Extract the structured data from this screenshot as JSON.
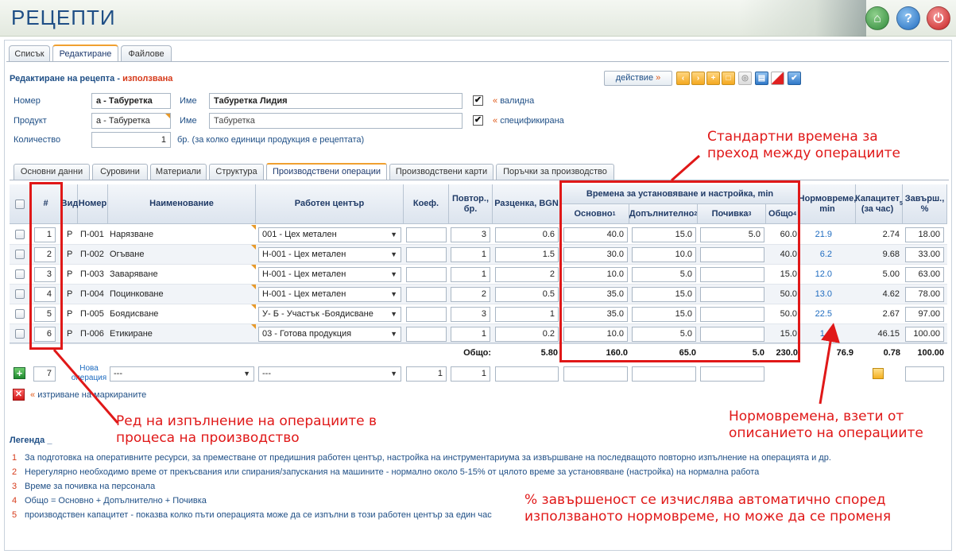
{
  "app": {
    "title": "РЕЦЕПТИ"
  },
  "header_buttons": {
    "home": "⌂",
    "help": "?",
    "power": "⏻"
  },
  "top_tabs": [
    "Списък",
    "Редактиране",
    "Файлове"
  ],
  "section": {
    "title": "Редактиране на рецепта",
    "separator": " - ",
    "status": "използвана"
  },
  "action_button": {
    "label": "действие",
    "arrow": "»"
  },
  "toolbar": [
    "‹",
    "›",
    "+",
    "□",
    "◎",
    "▤",
    "",
    "✔"
  ],
  "form": {
    "number_label": "Номер",
    "number_value": "а - Табуретка",
    "name_label": "Име",
    "name_value": "Табуретка Лидия",
    "valid_label": "валидна",
    "product_label": "Продукт",
    "product_value": "а - Табуретка",
    "name2_label": "Име",
    "name2_value": "Табуретка",
    "specified_label": "спецификирана",
    "quantity_label": "Количество",
    "quantity_value": "1",
    "quantity_hint": "бр. (за колко единици продукция е рецептата)",
    "guillemet": "«",
    "checkmark": "✔"
  },
  "sub_tabs": [
    "Основни данни",
    "Суровини",
    "Материали",
    "Структура",
    "Производствени операции",
    "Производствени карти",
    "Поръчки за производство"
  ],
  "table": {
    "headers": {
      "num": "#",
      "type": "Вид",
      "code": "Номер",
      "name": "Наименование",
      "workcenter": "Работен център",
      "coef": "Коеф.",
      "repeat": "Повтор., бр.",
      "cost": "Разценка, BGN",
      "times_group": "Времена за установяване и настройка, min",
      "basic": "Основно",
      "additional": "Допълнително",
      "rest": "Почивка",
      "total": "Общо",
      "norm": "Нормовреме, min",
      "capacity": "Капацитет (за час)",
      "completion": "Завърш., %"
    },
    "sup": {
      "basic": "1",
      "additional": "2",
      "rest": "3",
      "total": "4",
      "capacity": "5"
    },
    "rows": [
      {
        "num": "1",
        "type": "Р",
        "code": "П-001",
        "name": "Нарязване",
        "workcenter": "001 - Цех метален",
        "repeat": "3",
        "cost": "0.6",
        "basic": "40.0",
        "additional": "15.0",
        "rest": "5.0",
        "total": "60.0",
        "norm": "21.9",
        "capacity": "2.74",
        "completion": "18.00"
      },
      {
        "num": "2",
        "type": "Р",
        "code": "П-002",
        "name": "Огъване",
        "workcenter": "Н-001 - Цех метален",
        "repeat": "1",
        "cost": "1.5",
        "basic": "30.0",
        "additional": "10.0",
        "rest": "",
        "total": "40.0",
        "norm": "6.2",
        "capacity": "9.68",
        "completion": "33.00"
      },
      {
        "num": "3",
        "type": "Р",
        "code": "П-003",
        "name": "Заваряване",
        "workcenter": "Н-001 - Цех метален",
        "repeat": "1",
        "cost": "2",
        "basic": "10.0",
        "additional": "5.0",
        "rest": "",
        "total": "15.0",
        "norm": "12.0",
        "capacity": "5.00",
        "completion": "63.00"
      },
      {
        "num": "4",
        "type": "Р",
        "code": "П-004",
        "name": "Поцинковане",
        "workcenter": "Н-001 - Цех метален",
        "repeat": "2",
        "cost": "0.5",
        "basic": "35.0",
        "additional": "15.0",
        "rest": "",
        "total": "50.0",
        "norm": "13.0",
        "capacity": "4.62",
        "completion": "78.00"
      },
      {
        "num": "5",
        "type": "Р",
        "code": "П-005",
        "name": "Боядисване",
        "workcenter": "У- Б - Участък -Боядисване",
        "repeat": "3",
        "cost": "1",
        "basic": "35.0",
        "additional": "15.0",
        "rest": "",
        "total": "50.0",
        "norm": "22.5",
        "capacity": "2.67",
        "completion": "97.00"
      },
      {
        "num": "6",
        "type": "Р",
        "code": "П-006",
        "name": "Етикиране",
        "workcenter": "03 - Готова продукция",
        "repeat": "1",
        "cost": "0.2",
        "basic": "10.0",
        "additional": "5.0",
        "rest": "",
        "total": "15.0",
        "norm": "1.3",
        "capacity": "46.15",
        "completion": "100.00"
      }
    ],
    "totals": {
      "label": "Общо:",
      "cost": "5.80",
      "basic": "160.0",
      "additional": "65.0",
      "rest": "5.0",
      "total": "230.0",
      "norm": "76.9",
      "capacity": "0.78",
      "completion": "100.00"
    },
    "new_row": {
      "num": "7",
      "label": "Нова операция",
      "name_select": "---",
      "workcenter_select": "---",
      "coef": "1",
      "repeat": "1"
    },
    "delete_label": "изтриване на маркираните",
    "dropdown_arrow": "▼"
  },
  "legend": {
    "title": "Легенда",
    "items": [
      {
        "n": "1",
        "text": "За подготовка на оперативните ресурси, за преместване от предишния работен център, настройка на инструментариума за извършване на последващото повторно изпълнение на операцията и др."
      },
      {
        "n": "2",
        "text": "Нерегулярно необходимо време от прекъсвания или спирания/запускания на машините - нормално около 5-15% от цялото време за установяване (настройка) на нормална работа"
      },
      {
        "n": "3",
        "text": "Време за почивка на персонала"
      },
      {
        "n": "4",
        "text": "Общо = Основно + Допълнително + Почивка"
      },
      {
        "n": "5",
        "text": "производствен капацитет - показва колко пъти операцията може да се изпълни в този работен център за един час"
      }
    ]
  },
  "annotations": {
    "std_times_1": "Стандартни времена за",
    "std_times_2": "преход между операциите",
    "order_1": "Ред на изпълнение на операциите в",
    "order_2": "процеса на производство",
    "norm_1": "Нормовремена, взети от",
    "norm_2": "описанието на операциите",
    "pct_1": "% завършеност се изчислява автоматично според",
    "pct_2": "използваното нормовреме, но може да се променя"
  }
}
